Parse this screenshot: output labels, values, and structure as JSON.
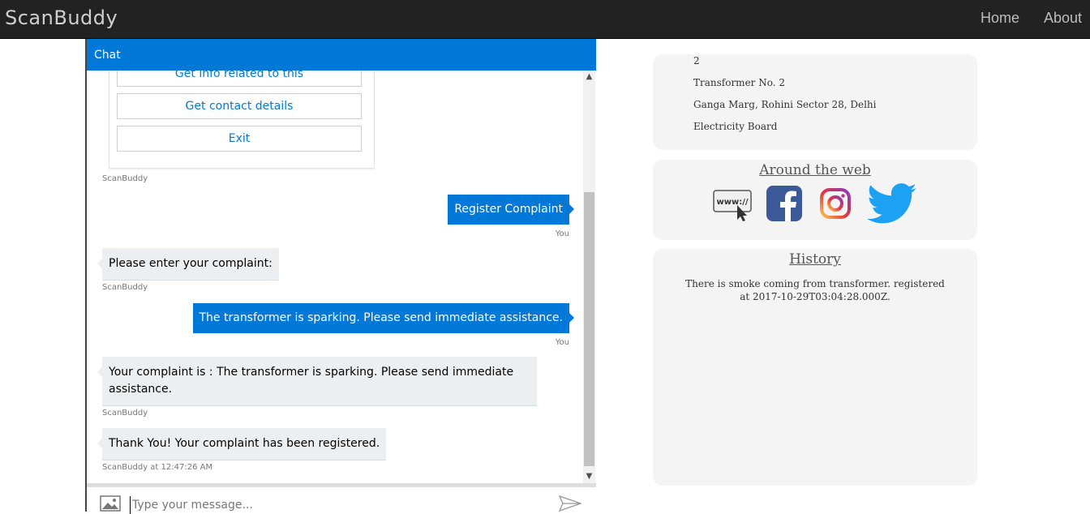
{
  "navbar": {
    "brand": "ScanBuddy",
    "links": {
      "home": "Home",
      "about": "About"
    }
  },
  "chat": {
    "header": "Chat",
    "card_buttons": [
      "Get info related to this",
      "Get contact details",
      "Exit"
    ],
    "messages": [
      {
        "from": "bot",
        "meta": "ScanBuddy"
      },
      {
        "from": "user",
        "text": "Register Complaint",
        "meta": "You"
      },
      {
        "from": "bot",
        "text": "Please enter your complaint:",
        "meta": "ScanBuddy"
      },
      {
        "from": "user",
        "text": "The transformer is sparking. Please send immediate assistance.",
        "meta": "You"
      },
      {
        "from": "bot",
        "text": "Your complaint is : The transformer is sparking. Please send immediate assistance.",
        "meta": "ScanBuddy"
      },
      {
        "from": "bot",
        "text": "Thank You! Your complaint has been registered.",
        "meta": "ScanBuddy at 12:47:26 AM"
      }
    ],
    "input": {
      "placeholder": "Type your message...",
      "value": ""
    },
    "icons": {
      "attach": "image-icon",
      "send": "send-icon"
    },
    "accent_color": "#0078d7"
  },
  "info": {
    "lines": [
      "2",
      "Transformer No. 2",
      "Ganga Marg, Rohini Sector 28, Delhi",
      "Electricity Board"
    ]
  },
  "web": {
    "title": "Around the web",
    "icons": [
      "website-icon",
      "facebook-icon",
      "instagram-icon",
      "twitter-icon"
    ]
  },
  "history": {
    "title": "History",
    "entries": [
      "There is smoke coming from transformer. registered at 2017-10-29T03:04:28.000Z."
    ]
  }
}
